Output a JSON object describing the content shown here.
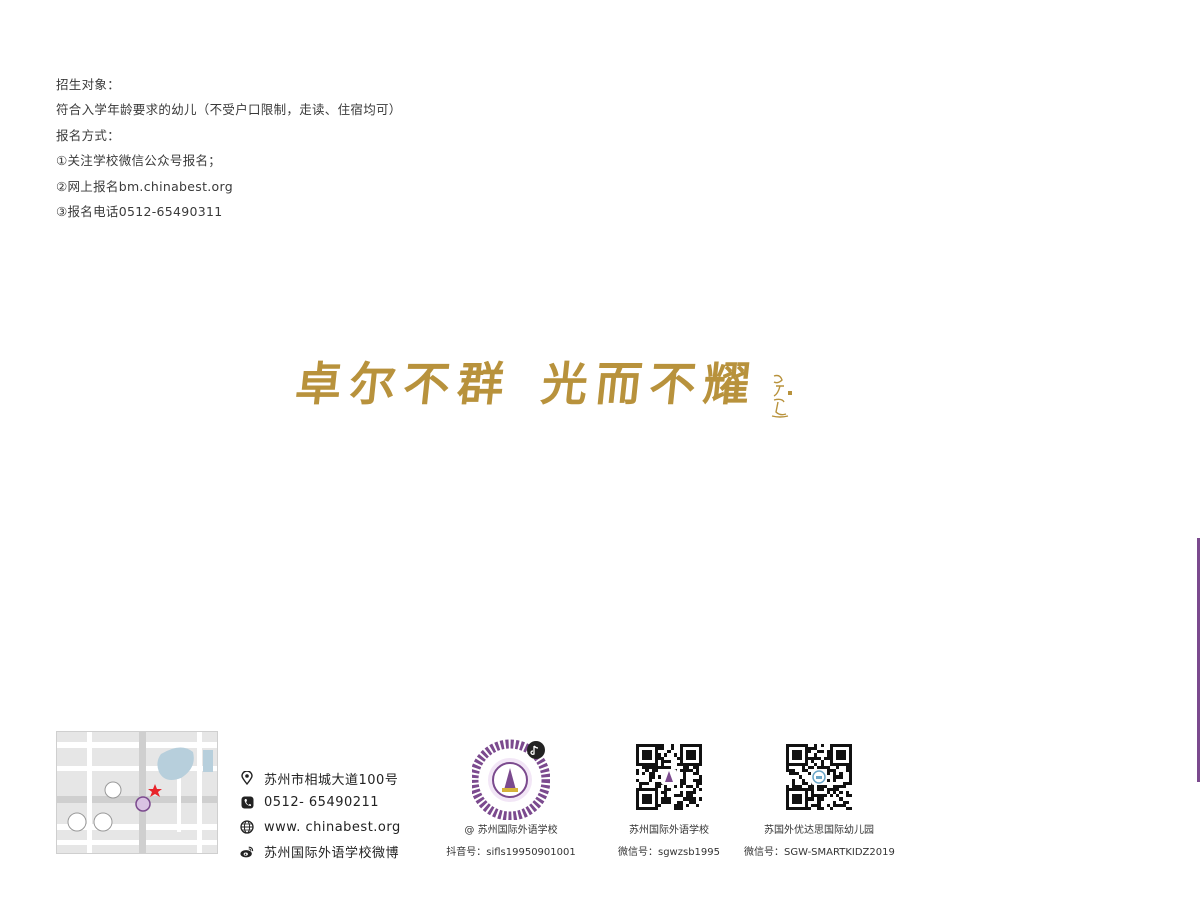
{
  "enrollment": {
    "target_title": "招生对象：",
    "target_desc": "符合入学年龄要求的幼儿（不受户口限制，走读、住宿均可）",
    "method_title": "报名方式：",
    "method_1": "①关注学校微信公众号报名；",
    "method_2": "②网上报名bm.chinabest.org",
    "method_3": "③报名电话0512-65490311"
  },
  "motto": {
    "line1": "卓尔不群",
    "line2": "光而不耀",
    "seal_text": "岳子超"
  },
  "contacts": [
    {
      "icon": "location-pin-icon",
      "text": "苏州市相城大道100号"
    },
    {
      "icon": "phone-icon",
      "text": "0512- 65490211"
    },
    {
      "icon": "globe-icon",
      "text": "www. chinabest.org"
    },
    {
      "icon": "weibo-icon",
      "text": "苏州国际外语学校微博"
    }
  ],
  "qr_codes": [
    {
      "icon": "douyin-qr-code",
      "caption": "@ 苏州国际外语学校",
      "id_line": "抖音号：sifls19950901001"
    },
    {
      "icon": "wechat-qr-code",
      "caption": "苏州国际外语学校",
      "id_line": "微信号：sgwzsb1995"
    },
    {
      "icon": "wechat-qr-code",
      "caption": "苏国外优达思国际幼儿园",
      "id_line": "微信号：SGW-SMARTKIDZ2019"
    }
  ],
  "colors": {
    "gold": "#b8923c",
    "purple": "#7b4a8e",
    "text": "#3a3a3a",
    "marker_red": "#e8232a"
  }
}
